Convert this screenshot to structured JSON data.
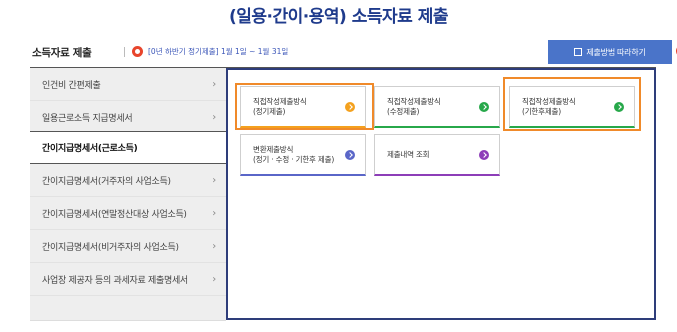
{
  "page": {
    "title": "(일용·간이·용역) 소득자료 제출"
  },
  "topbar": {
    "section_title": "소득자료 제출",
    "period_label": "[0년 하반기 정기제출]",
    "period_dates": "1월 1일 ~ 1월 31일",
    "guide_button": "제출방법 따라하기",
    "help_icon": "?"
  },
  "sidebar": {
    "items": [
      {
        "label": "인건비 간편제출"
      },
      {
        "label": "일용근로소득 지급명세서"
      },
      {
        "label": "간이지급명세서(근로소득)"
      },
      {
        "label": "간이지급명세서(거주자의 사업소득)"
      },
      {
        "label": "간이지급명세서(연말정산대상 사업소득)"
      },
      {
        "label": "간이지급명세서(비거주자의 사업소득)"
      },
      {
        "label": "사업장 제공자 등의 과세자료 제출명세서"
      }
    ],
    "active_index": 2,
    "chevron": "›"
  },
  "cards": [
    {
      "line1": "직접작성제출방식",
      "line2": "(정기제출)",
      "accent": "#f4a11e"
    },
    {
      "line1": "직접작성제출방식",
      "line2": "(수정제출)",
      "accent": "#27a84a"
    },
    {
      "line1": "직접작성제출방식",
      "line2": "(기한후제출)",
      "accent": "#27a84a"
    },
    {
      "line1": "변환제출방식",
      "line2": "(정기 · 수정 · 기한후 제출)",
      "accent": "#5a66c8"
    },
    {
      "line1": "제출내역 조회",
      "line2": "",
      "accent": "#8d3db8"
    }
  ],
  "colors": {
    "title": "#1f3b8c",
    "button": "#4a74c9",
    "highlight": "#f08a2a",
    "notice": "#e8452c"
  }
}
